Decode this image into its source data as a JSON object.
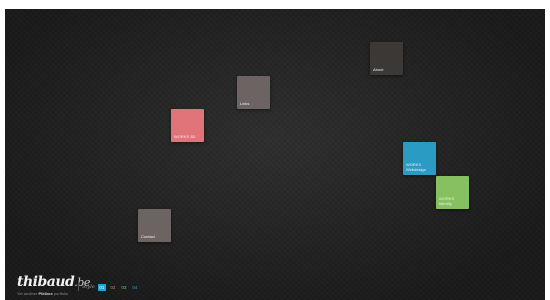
{
  "tiles": [
    {
      "id": "about",
      "label": "About",
      "color": "#3c3836"
    },
    {
      "id": "links",
      "label": "Links",
      "color": "#6b6462"
    },
    {
      "id": "works-3d",
      "label": "WORKS 3D",
      "color": "#e07478"
    },
    {
      "id": "works-webdesign",
      "label": "WORKS\nWebdesign",
      "color": "#2a9cc4"
    },
    {
      "id": "works-identity",
      "label": "WORKS\nIdentity",
      "color": "#86c060"
    },
    {
      "id": "contact",
      "label": "Contact",
      "color": "#6b6462"
    }
  ],
  "footer": {
    "brand_name": "thibaud",
    "brand_tld": ".be",
    "tagline_prefix": "Yet another ",
    "tagline_bold": "Pikibox",
    "tagline_suffix": " portfolio",
    "style_label": "Style",
    "style_options": [
      "01",
      "02",
      "03",
      "04"
    ],
    "style_active": "01",
    "style_colors": [
      "#ffffff",
      "#e07478",
      "#86c060",
      "#2a9cc4"
    ]
  }
}
